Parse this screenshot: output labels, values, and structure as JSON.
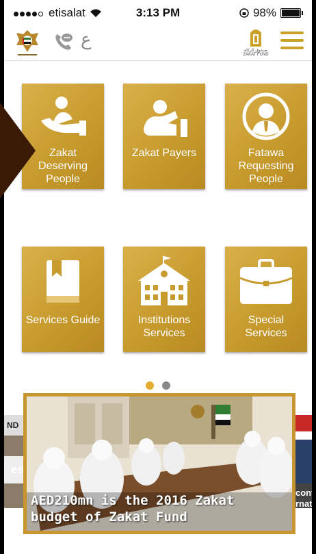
{
  "status_bar": {
    "carrier": "etisalat",
    "time": "3:13 PM",
    "battery": "98%"
  },
  "header": {
    "lang_toggle": "ع",
    "logo_arabic": "صندوق الزكاة",
    "logo_english": "ZAKAT FUND"
  },
  "tiles": [
    {
      "label": "Zakat Deserving People",
      "icon": "hand-person-icon"
    },
    {
      "label": "Zakat Payers",
      "icon": "giving-hand-icon"
    },
    {
      "label": "Fatawa Requesting People",
      "icon": "person-avatar-icon"
    },
    {
      "label": "Services Guide",
      "icon": "book-icon"
    },
    {
      "label": "Institutions Services",
      "icon": "school-building-icon"
    },
    {
      "label": "Special Services",
      "icon": "briefcase-icon"
    }
  ],
  "pager": {
    "active": 1,
    "count": 2,
    "active_color": "#e3ac2e",
    "inactive_color": "#888888"
  },
  "news": {
    "headline": "AED210mn is the 2016 Zakat budget of Zakat Fund",
    "left_fragment": "es",
    "left_top_fragment": "ND",
    "right_fragment": "cont\nrnat"
  },
  "colors": {
    "gold": "#c9a227",
    "tile": "#d3a83e"
  }
}
